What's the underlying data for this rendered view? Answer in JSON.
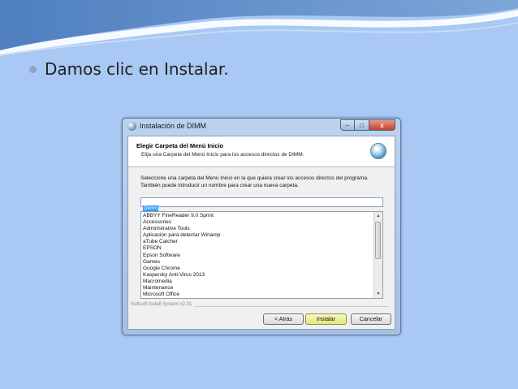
{
  "slide": {
    "bullet_text": "Damos clic en Instalar."
  },
  "window": {
    "title": "Instalación de DIMM",
    "controls": {
      "minimize": "–",
      "maximize": "□",
      "close": "x"
    }
  },
  "installer": {
    "header_title": "Elegir Carpeta del Menú Inicio",
    "header_subtitle": "Elija una Carpeta del Menú Inicio para los accesos directos de DIMM.",
    "description": "Seleccione una carpeta del Menú Inicio en la que quiera crear los accesos directos del programa. También puede introducir un nombre para crear una nueva carpeta.",
    "folder_name_value": "Dimm",
    "folders": [
      "ABBYY FineReader 9.0 Sprint",
      "Accessories",
      "Administrative Tools",
      "Aplicación para detectar Winamp",
      "aTube Catcher",
      "EPSON",
      "Epson Software",
      "Games",
      "Google Chrome",
      "Kaspersky Anti-Virus 2013",
      "Macromedia",
      "Maintenance",
      "Microsoft Office"
    ],
    "branding": "Nullsoft Install System v2.31",
    "buttons": {
      "back": "< Atrás",
      "install": "Instalar",
      "cancel": "Cancelar"
    }
  },
  "colors": {
    "background": "#a9c8f3",
    "install_button": "#e2e77c"
  }
}
